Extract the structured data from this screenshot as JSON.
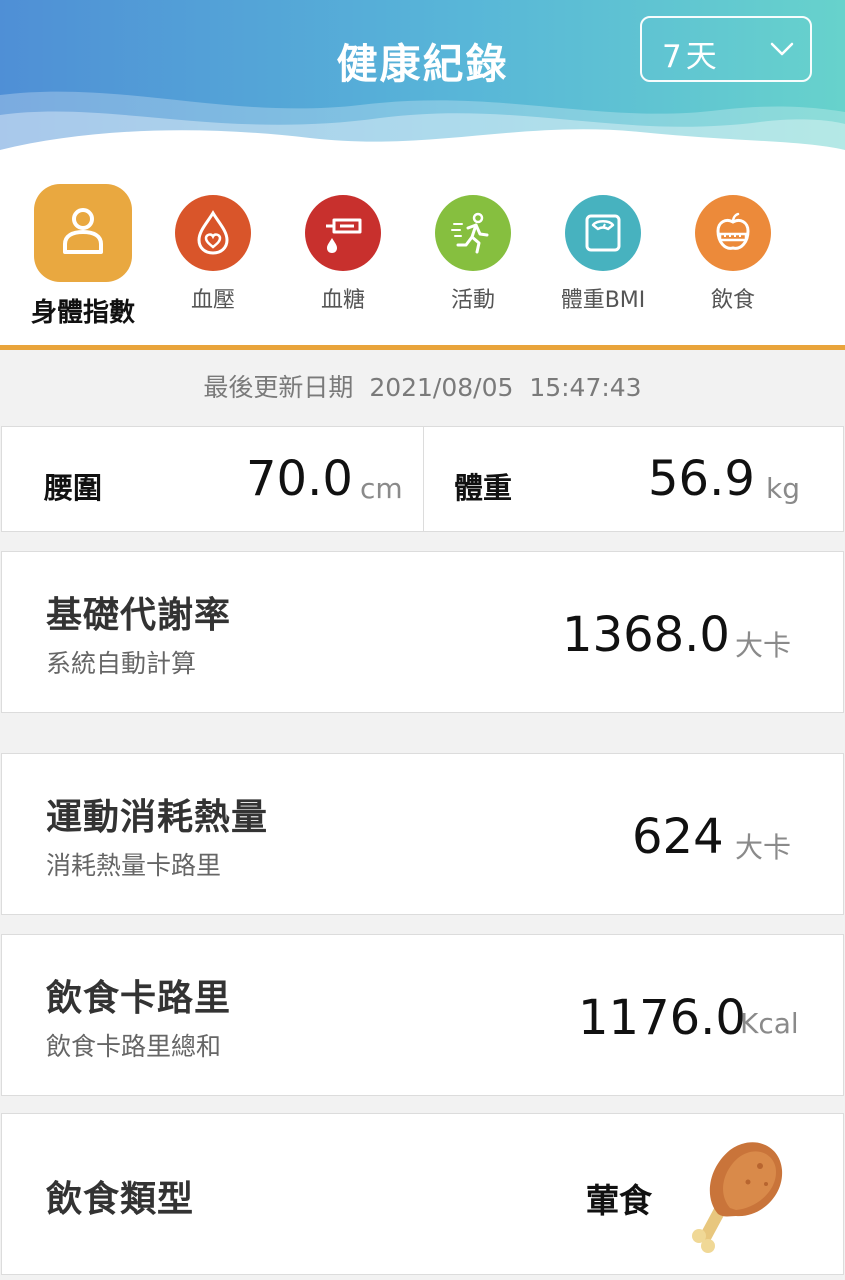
{
  "header": {
    "title": "健康紀錄",
    "range_value": "7天"
  },
  "categories": [
    {
      "label": "身體指數",
      "icon": "person-icon",
      "color": "#e9a840",
      "active": true
    },
    {
      "label": "血壓",
      "icon": "blood-drop-heart-icon",
      "color": "#d9552a",
      "active": false
    },
    {
      "label": "血糖",
      "icon": "glucose-meter-icon",
      "color": "#c8302d",
      "active": false
    },
    {
      "label": "活動",
      "icon": "running-person-icon",
      "color": "#86bf3f",
      "active": false
    },
    {
      "label": "體重BMI",
      "icon": "scale-icon",
      "color": "#47b2bf",
      "active": false
    },
    {
      "label": "飲食",
      "icon": "apple-icon",
      "color": "#ec8a3a",
      "active": false
    }
  ],
  "colors": {
    "accent": "#e9a43b"
  },
  "last_updated": {
    "label": "最後更新日期",
    "date": "2021/08/05",
    "time": "15:47:43"
  },
  "waist": {
    "label": "腰圍",
    "value": "70.0",
    "unit": "cm"
  },
  "weight": {
    "label": "體重",
    "value": "56.9",
    "unit": "kg"
  },
  "bmr": {
    "title": "基礎代謝率",
    "subtitle": "系統自動計算",
    "value": "1368.0",
    "unit": "大卡"
  },
  "exercise": {
    "title": "運動消耗熱量",
    "subtitle": "消耗熱量卡路里",
    "value": "624",
    "unit": "大卡"
  },
  "diet_calories": {
    "title": "飲食卡路里",
    "subtitle": "飲食卡路里總和",
    "value": "1176.0",
    "unit": "Kcal"
  },
  "diet_type": {
    "title": "飲食類型",
    "value": "葷食",
    "icon": "chicken-drumstick-icon"
  }
}
